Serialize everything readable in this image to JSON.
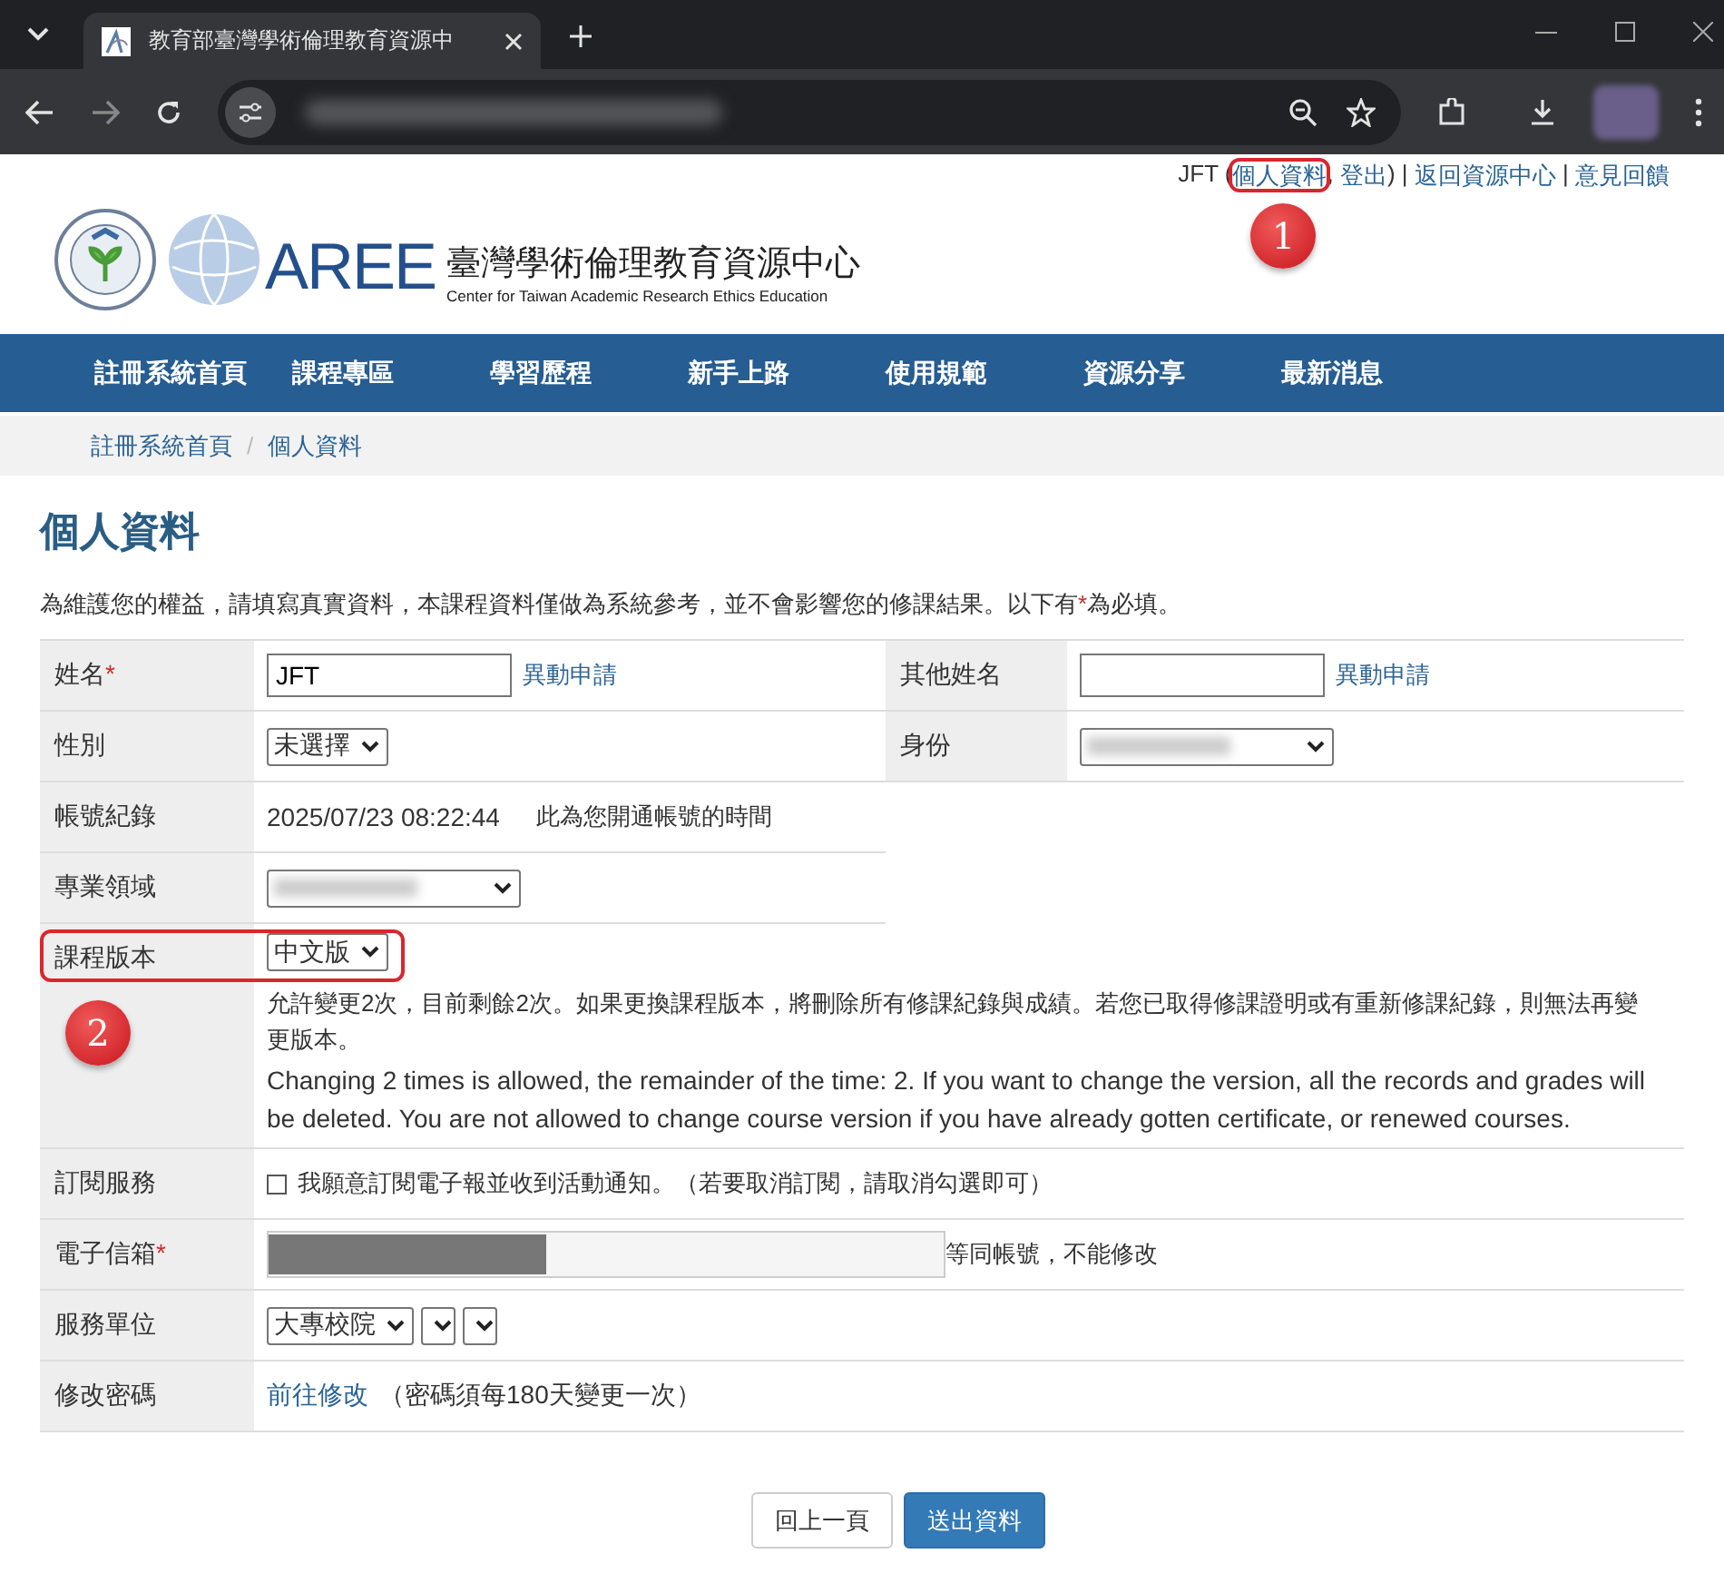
{
  "browser": {
    "tab_title": "教育部臺灣學術倫理教育資源中",
    "url_redacted": true
  },
  "top_links": [
    {
      "kind": "text",
      "text": "JFT ("
    },
    {
      "kind": "link",
      "text": "個人資料",
      "callout": "1"
    },
    {
      "kind": "text",
      "text": ", "
    },
    {
      "kind": "link",
      "text": "登出"
    },
    {
      "kind": "text",
      "text": ") | "
    },
    {
      "kind": "link",
      "text": "返回資源中心"
    },
    {
      "kind": "text",
      "text": " | "
    },
    {
      "kind": "link",
      "text": "意見回饋"
    }
  ],
  "logo": {
    "brand": "AREE",
    "title": "臺灣學術倫理教育資源中心",
    "subtitle": "Center for Taiwan Academic Research Ethics Education"
  },
  "nav": [
    "註冊系統首頁",
    "課程專區",
    "學習歷程",
    "新手上路",
    "使用規範",
    "資源分享",
    "最新消息"
  ],
  "breadcrumb": {
    "separator": "/",
    "items": [
      "註冊系統首頁",
      "個人資料"
    ]
  },
  "heading": "個人資料",
  "intro": {
    "before": "為維護您的權益，請填寫真實資料，本課程資料僅做為系統參考，並不會影響您的修課結果。以下有",
    "mark": "*",
    "after": "為必填。"
  },
  "form": [
    {
      "half": false,
      "fields": [
        {
          "label": "姓名",
          "required_mark": "*",
          "kind": "input",
          "value": "JFT",
          "link": "異動申請"
        },
        {
          "label": "其他姓名",
          "kind": "input",
          "link": "異動申請"
        }
      ]
    },
    {
      "half": false,
      "fields": [
        {
          "label": "性別",
          "kind": "select",
          "selects": [
            {
              "value": "未選擇"
            }
          ]
        },
        {
          "label": "身份",
          "kind": "select",
          "selects": [
            {
              "redacted": true
            }
          ]
        }
      ]
    },
    {
      "half": true,
      "fields": [
        {
          "label": "帳號紀錄",
          "kind": "record",
          "value": "2025/07/23 08:22:44",
          "note": "此為您開通帳號的時間"
        }
      ]
    },
    {
      "half": true,
      "fields": [
        {
          "label": "專業領域",
          "kind": "select",
          "selects": [
            {
              "redacted": true
            }
          ]
        }
      ]
    },
    {
      "half": false,
      "callout": "2",
      "fields": [
        {
          "label": "課程版本",
          "kind": "version",
          "selects": [
            {
              "value": "中文版"
            }
          ],
          "notes": [
            "允許變更2次，目前剩餘2次。如果更換課程版本，將刪除所有修課紀錄與成績。若您已取得修課證明或有重新修課紀錄，則無法再變更版本。",
            "Changing 2 times is allowed, the remainder of the time: 2. If you want to change the version, all the records and grades will be deleted. You are not allowed to change course version if you have already gotten certificate, or renewed courses."
          ]
        }
      ]
    },
    {
      "half": false,
      "fields": [
        {
          "label": "訂閱服務",
          "kind": "checkbox",
          "checked": false,
          "text": "我願意訂閱電子報並收到活動通知。（若要取消訂閱，請取消勾選即可）"
        }
      ]
    },
    {
      "half": false,
      "fields": [
        {
          "label": "電子信箱",
          "required_mark": "*",
          "kind": "readonly",
          "redacted": true,
          "note": "等同帳號，不能修改"
        }
      ]
    },
    {
      "half": false,
      "fields": [
        {
          "label": "服務單位",
          "kind": "select",
          "selects": [
            {
              "value": "大專校院"
            },
            {
              "redacted": false
            },
            {
              "redacted": false
            }
          ]
        }
      ]
    },
    {
      "half": false,
      "fields": [
        {
          "label": "修改密碼",
          "kind": "linknote",
          "link": "前往修改",
          "note": "（密碼須每180天變更一次）"
        }
      ]
    }
  ],
  "buttons": [
    {
      "label": "回上一頁",
      "kind": "secondary"
    },
    {
      "label": "送出資料",
      "kind": "primary"
    }
  ]
}
